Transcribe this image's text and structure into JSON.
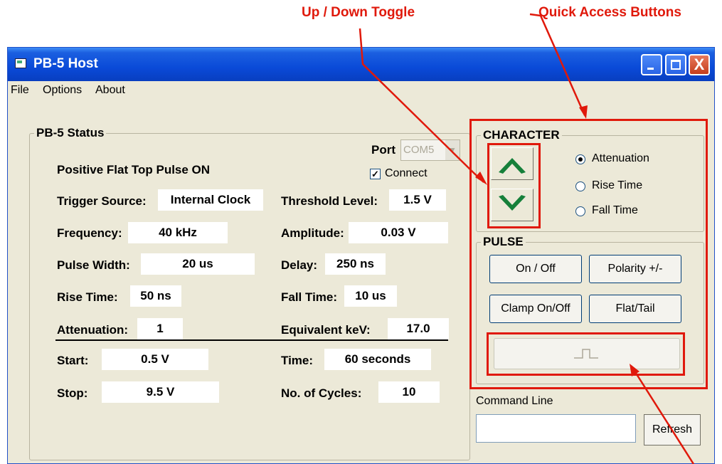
{
  "annotations": {
    "up_down_toggle": "Up / Down Toggle",
    "quick_access": "Quick Access Buttons"
  },
  "window": {
    "title": "PB-5 Host",
    "close_glyph": "X"
  },
  "menu": [
    "File",
    "Options",
    "About"
  ],
  "status": {
    "legend": "PB-5 Status",
    "mode": "Positive Flat Top Pulse ON",
    "port_label": "Port",
    "port_value": "COM5",
    "connect_label": "Connect",
    "connect_checked": true,
    "trigger_source": {
      "label": "Trigger Source:",
      "value": "Internal Clock"
    },
    "threshold_level": {
      "label": "Threshold Level:",
      "value": "1.5 V"
    },
    "frequency": {
      "label": "Frequency:",
      "value": "40 kHz"
    },
    "amplitude": {
      "label": "Amplitude:",
      "value": "0.03 V"
    },
    "pulse_width": {
      "label": "Pulse Width:",
      "value": "20 us"
    },
    "delay": {
      "label": "Delay:",
      "value": "250 ns"
    },
    "rise_time": {
      "label": "Rise Time:",
      "value": "50 ns"
    },
    "fall_time": {
      "label": "Fall Time:",
      "value": "10 us"
    },
    "attenuation": {
      "label": "Attenuation:",
      "value": "1"
    },
    "equivalent_kev": {
      "label": "Equivalent keV:",
      "value": "17.0"
    },
    "start": {
      "label": "Start:",
      "value": "0.5 V"
    },
    "time": {
      "label": "Time:",
      "value": "60 seconds"
    },
    "stop": {
      "label": "Stop:",
      "value": "9.5 V"
    },
    "cycles": {
      "label": "No. of Cycles:",
      "value": "10"
    }
  },
  "character": {
    "legend": "CHARACTER",
    "options": [
      "Attenuation",
      "Rise Time",
      "Fall Time"
    ],
    "selected": "Attenuation",
    "up_icon": "chevron-up-icon",
    "down_icon": "chevron-down-icon"
  },
  "pulse": {
    "legend": "PULSE",
    "on_off": "On / Off",
    "polarity": "Polarity +/-",
    "clamp": "Clamp On/Off",
    "flat_tail": "Flat/Tail",
    "pulse_icon": "pulse-waveform-icon"
  },
  "command": {
    "label": "Command Line",
    "value": "",
    "refresh": "Refresh"
  },
  "colors": {
    "accent_green": "#16803a",
    "annotation_red": "#e0190b",
    "titlebar_blue": "#0a4ad8"
  }
}
